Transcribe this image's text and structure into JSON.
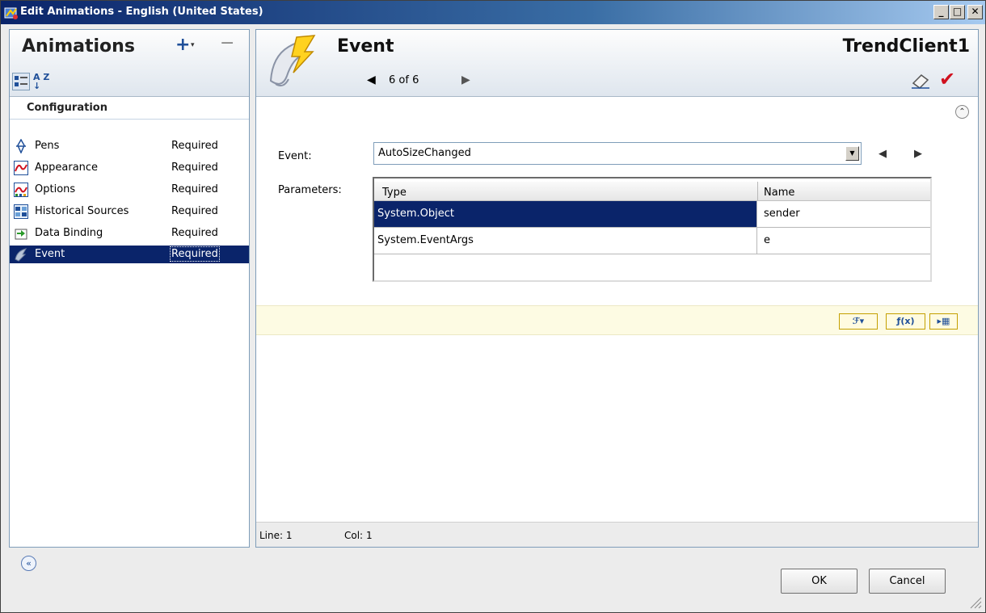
{
  "window": {
    "title": "Edit Animations - English (United States)",
    "minimize_glyph": "_",
    "maximize_glyph": "□",
    "close_glyph": "✕"
  },
  "left": {
    "title": "Animations",
    "add_glyph": "+",
    "add_caret_glyph": "▾",
    "remove_glyph": "−",
    "sort_az_glyph": "A Z ↓",
    "section": "Configuration",
    "items": [
      {
        "label": "Pens",
        "status": "Required",
        "icon": "pen-icon"
      },
      {
        "label": "Appearance",
        "status": "Required",
        "icon": "appearance-icon"
      },
      {
        "label": "Options",
        "status": "Required",
        "icon": "options-icon"
      },
      {
        "label": "Historical Sources",
        "status": "Required",
        "icon": "historical-sources-icon"
      },
      {
        "label": "Data Binding",
        "status": "Required",
        "icon": "data-binding-icon"
      },
      {
        "label": "Event",
        "status": "Required",
        "icon": "event-icon",
        "selected": true
      }
    ]
  },
  "right": {
    "title": "Event",
    "nav": {
      "prev_glyph": "◀",
      "next_glyph": "▶",
      "count": "6 of 6"
    },
    "object_name": "TrendClient1",
    "accept_glyph": "✔",
    "collapse_glyph": "⌃",
    "event_label": "Event:",
    "event_value": "AutoSizeChanged",
    "dropdown_glyph": "▼",
    "event_prev_glyph": "◀",
    "event_next_glyph": "▶",
    "parameters_label": "Parameters:",
    "grid": {
      "headers": [
        "Type",
        "Name"
      ],
      "rows": [
        {
          "type": "System.Object",
          "name": "sender",
          "selected": true
        },
        {
          "type": "System.EventArgs",
          "name": "e"
        }
      ]
    },
    "toolbar": {
      "insert_event_glyph": "ℱ▾",
      "insert_function_glyph": "ƒ(x)",
      "insert_reference_glyph": "▸▦"
    },
    "status": {
      "line_label": "Line:",
      "line_value": "1",
      "col_label": "Col:",
      "col_value": "1"
    }
  },
  "footer": {
    "expand_glyph": "«",
    "ok_label": "OK",
    "cancel_label": "Cancel"
  },
  "colors": {
    "selection": "#0a246a",
    "accent_red": "#d0101e",
    "script_band": "#fdfbe3"
  }
}
